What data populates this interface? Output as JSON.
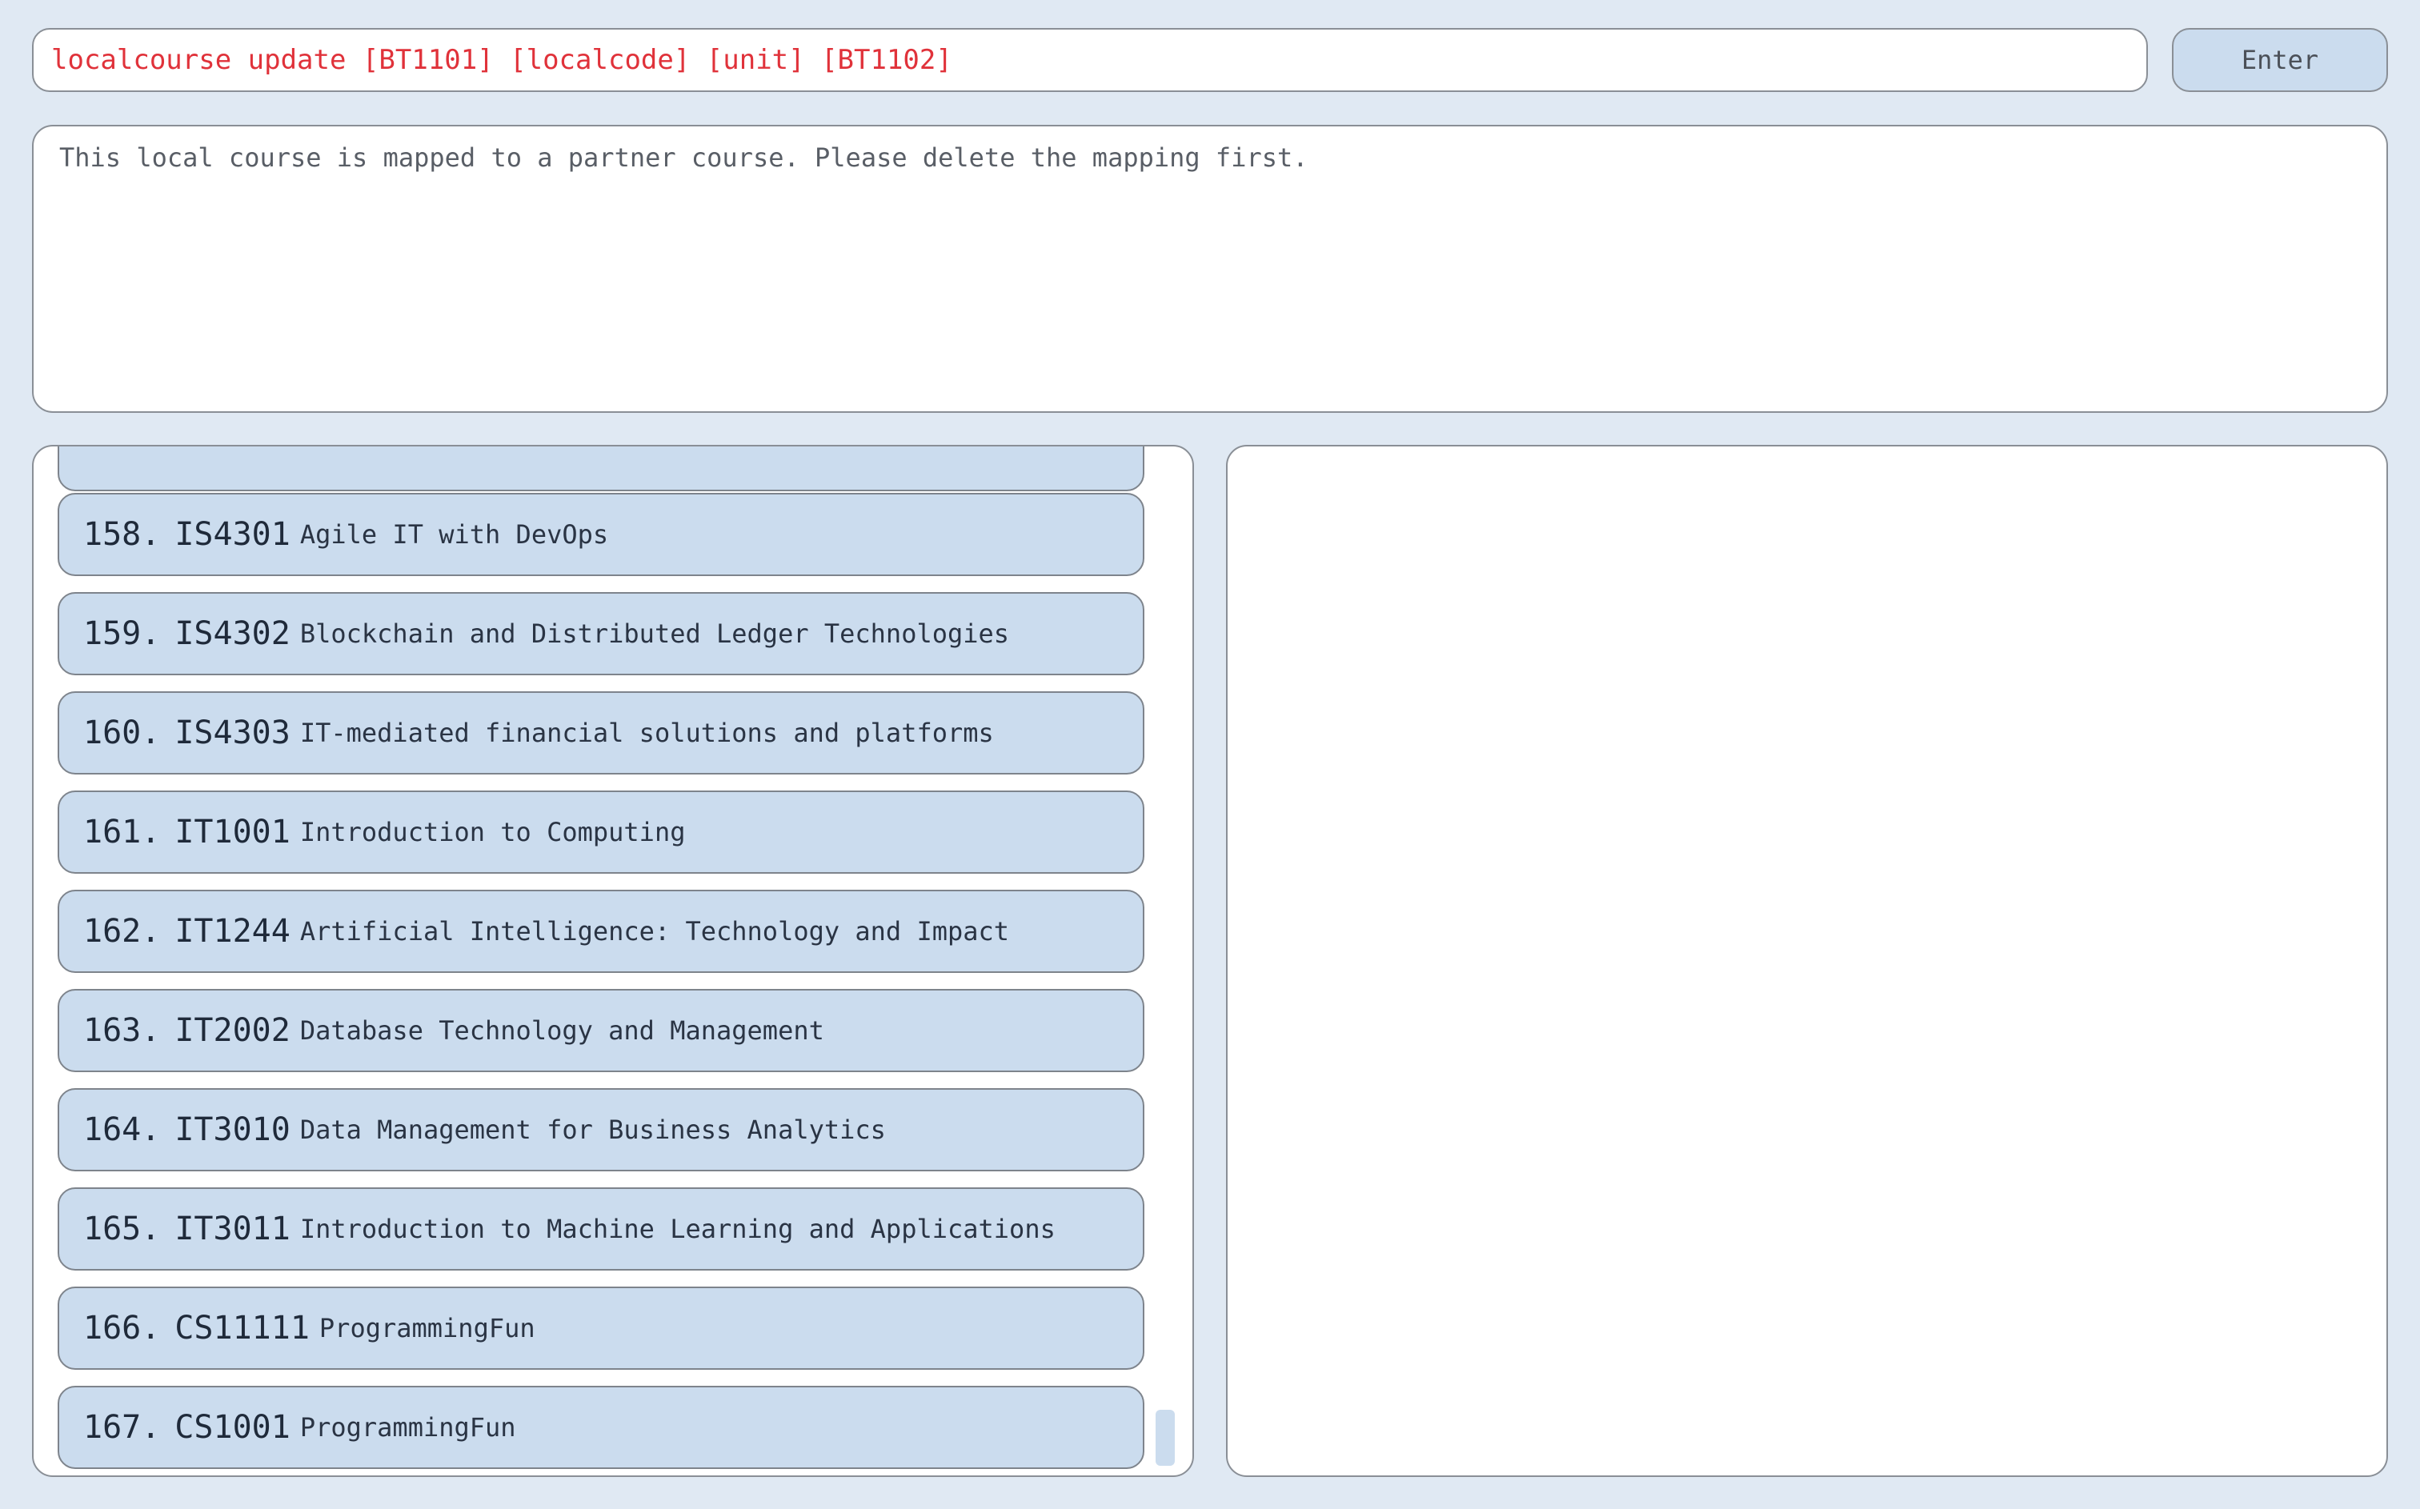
{
  "command": {
    "value": "localcourse update [BT1101] [localcode] [unit] [BT1102]"
  },
  "enter_button": {
    "label": "Enter"
  },
  "result": {
    "message": "This local course is mapped to a partner course. Please delete the mapping first."
  },
  "course_list": {
    "items": [
      {
        "index": "",
        "code": "",
        "name": ""
      },
      {
        "index": "158.",
        "code": "IS4301",
        "name": "Agile IT with DevOps"
      },
      {
        "index": "159.",
        "code": "IS4302",
        "name": "Blockchain and Distributed Ledger Technologies"
      },
      {
        "index": "160.",
        "code": "IS4303",
        "name": "IT-mediated financial solutions and platforms"
      },
      {
        "index": "161.",
        "code": "IT1001",
        "name": "Introduction to Computing"
      },
      {
        "index": "162.",
        "code": "IT1244",
        "name": "Artificial Intelligence: Technology and Impact"
      },
      {
        "index": "163.",
        "code": "IT2002",
        "name": "Database Technology and Management"
      },
      {
        "index": "164.",
        "code": "IT3010",
        "name": "Data Management for Business Analytics"
      },
      {
        "index": "165.",
        "code": "IT3011",
        "name": "Introduction to Machine Learning and Applications"
      },
      {
        "index": "166.",
        "code": "CS11111",
        "name": "ProgrammingFun"
      },
      {
        "index": "167.",
        "code": "CS1001",
        "name": "ProgrammingFun"
      }
    ]
  },
  "colors": {
    "background": "#e0e9f3",
    "item_fill": "#cbdcee",
    "command_text": "#e0323a"
  }
}
